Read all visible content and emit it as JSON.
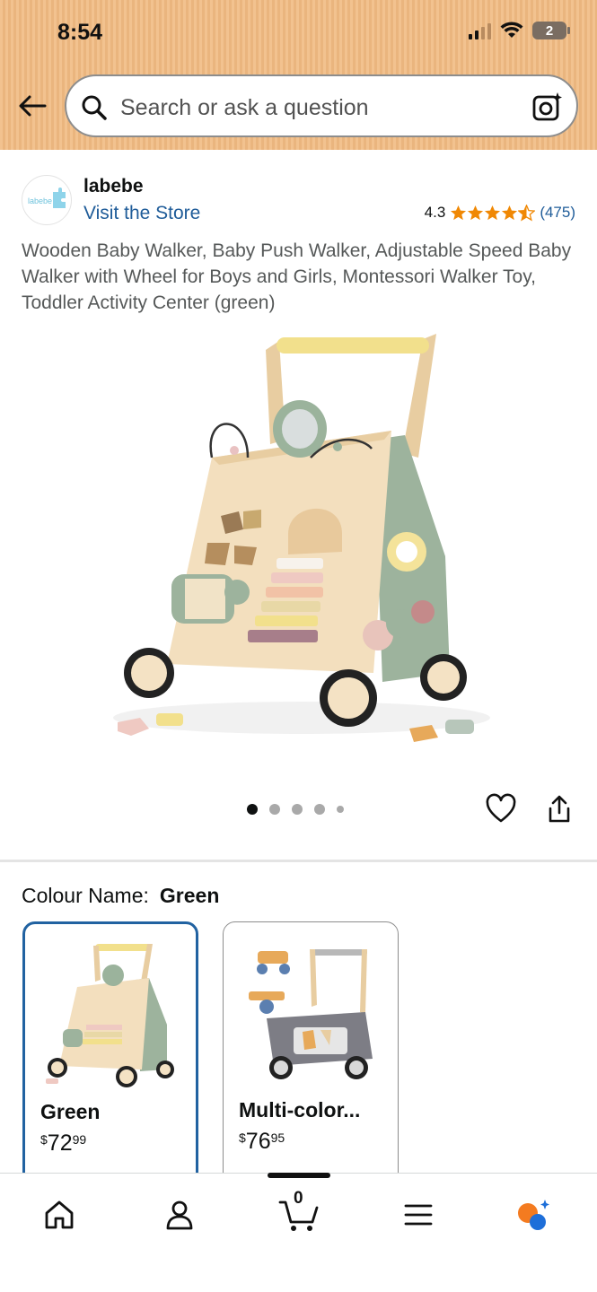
{
  "status_bar": {
    "time": "8:54",
    "battery": "2"
  },
  "search": {
    "placeholder": "Search or ask a question"
  },
  "brand": {
    "logo_text": "labebe",
    "name": "labebe",
    "visit_store": "Visit the Store",
    "rating": "4.3",
    "rating_count": "(475)",
    "stars": 4.3
  },
  "product": {
    "title": "Wooden Baby Walker, Baby Push Walker, Adjustable Speed Baby Walker with Wheel for Boys and Girls, Montessori Walker Toy, Toddler Activity Center (green)"
  },
  "carousel": {
    "total": 5,
    "active_index": 0
  },
  "variation": {
    "label": "Colour Name:",
    "selected": "Green",
    "options": [
      {
        "name": "Green",
        "price_symbol": "$",
        "price_whole": "72",
        "price_cents": "99"
      },
      {
        "name": "Multi-color...",
        "price_symbol": "$",
        "price_whole": "76",
        "price_cents": "95"
      }
    ]
  },
  "bottom_nav": {
    "cart_count": "0"
  },
  "colors": {
    "header_bg": "#eab57e",
    "link": "#1f5c99",
    "star": "#f08804",
    "selected_border": "#2162a1"
  }
}
